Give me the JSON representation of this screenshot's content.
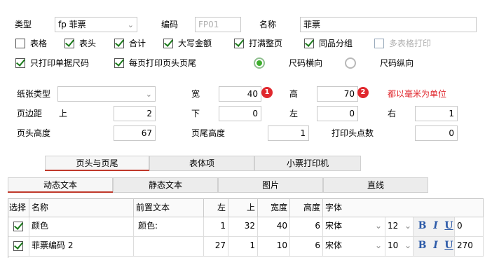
{
  "top": {
    "type_label": "类型",
    "type_value": "fp 菲票",
    "code_label": "编码",
    "code_value": "FP01",
    "name_label": "名称",
    "name_value": "菲票"
  },
  "checks_row1": [
    {
      "label": "表格",
      "checked": false
    },
    {
      "label": "表头",
      "checked": true
    },
    {
      "label": "合计",
      "checked": true
    },
    {
      "label": "大写金额",
      "checked": true
    },
    {
      "label": "打满整页",
      "checked": true
    },
    {
      "label": "同品分组",
      "checked": true
    },
    {
      "label": "多表格打印",
      "checked": false,
      "disabled": true
    }
  ],
  "checks_row2": [
    {
      "label": "只打印单据尺码",
      "checked": true
    },
    {
      "label": "每页打印页头页尾",
      "checked": true
    }
  ],
  "radios": [
    {
      "label": "尺码横向",
      "selected": true
    },
    {
      "label": "尺码纵向",
      "selected": false
    }
  ],
  "paper": {
    "paper_type_label": "纸张类型",
    "paper_type_value": "",
    "width_label": "宽",
    "width_value": "40",
    "badge1": "1",
    "height_label": "高",
    "height_value": "70",
    "badge2": "2",
    "unit_note": "都以毫米为单位",
    "margin_label": "页边距",
    "top_label": "上",
    "top_value": "2",
    "bottom_label": "下",
    "bottom_value": "0",
    "left_label": "左",
    "left_value": "0",
    "right_label": "右",
    "right_value": "1",
    "header_h_label": "页头高度",
    "header_h_value": "67",
    "footer_h_label": "页尾高度",
    "footer_h_value": "1",
    "dots_label": "打印头点数",
    "dots_value": "0"
  },
  "main_tabs": [
    "页头与页尾",
    "表体项",
    "小票打印机"
  ],
  "sub_tabs": [
    "动态文本",
    "静态文本",
    "图片",
    "直线"
  ],
  "grid": {
    "headers": [
      "选择",
      "名称",
      "前置文本",
      "左",
      "上",
      "宽度",
      "高度",
      "字体"
    ],
    "rows": [
      {
        "checked": true,
        "name": "颜色",
        "prefix": "颜色:",
        "left": "1",
        "top": "32",
        "width": "40",
        "height": "6",
        "font": "宋体",
        "size": "12",
        "extra": "0"
      },
      {
        "checked": true,
        "name": "菲票编码 2",
        "prefix": "",
        "left": "27",
        "top": "1",
        "width": "10",
        "height": "6",
        "font": "宋体",
        "size": "10",
        "extra": "270"
      }
    ],
    "bold": "B",
    "italic": "I",
    "underline": "U"
  },
  "colors": {
    "accent_red": "#e0282e",
    "tab_underline": "#c0392b",
    "check_green": "#1a7a1a",
    "radio_green": "#3eae2e"
  }
}
